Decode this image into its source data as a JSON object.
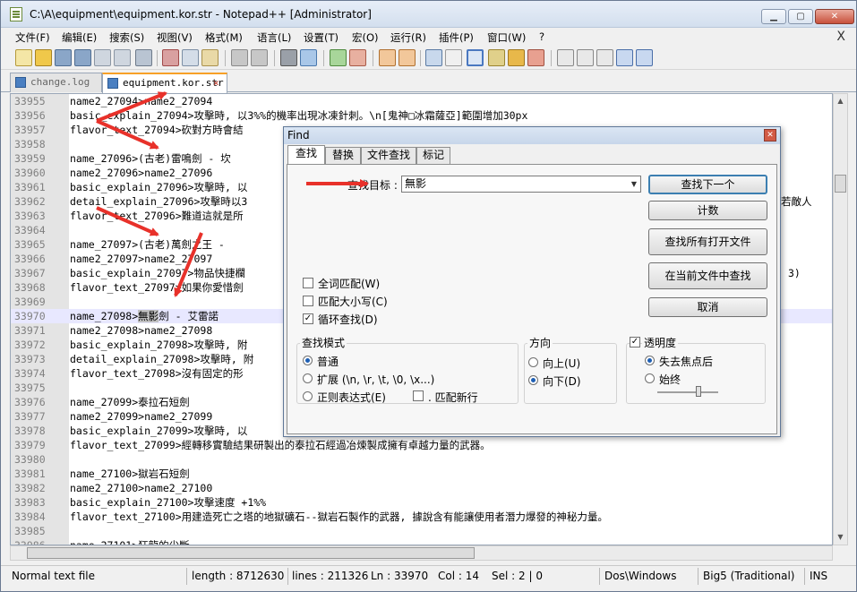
{
  "window": {
    "title": "C:\\A\\equipment\\equipment.kor.str - Notepad++ [Administrator]",
    "min_label": "▁",
    "max_label": "▢",
    "close_label": "✕"
  },
  "menu": {
    "items": [
      "文件(F)",
      "编辑(E)",
      "搜索(S)",
      "视图(V)",
      "格式(M)",
      "语言(L)",
      "设置(T)",
      "宏(O)",
      "运行(R)",
      "插件(P)",
      "窗口(W)",
      "?"
    ],
    "close": "X"
  },
  "tabs": [
    {
      "label": "change.log"
    },
    {
      "label": "equipment.kor.str"
    }
  ],
  "editor": {
    "lines": [
      {
        "num": "33955",
        "text": "name2_27094>name2_27094"
      },
      {
        "num": "33956",
        "text": "basic_explain_27094>攻擊時, 以3%%的機率出現冰凍針刺。\\n[鬼神□冰霜薩亞]範圍增加30px"
      },
      {
        "num": "33957",
        "text": "flavor_text_27094>砍對方時會結"
      },
      {
        "num": "33958",
        "text": ""
      },
      {
        "num": "33959",
        "text": "name_27096>(古老)雷鳴劍 - 坎"
      },
      {
        "num": "33960",
        "text": "name2_27096>name2_27096"
      },
      {
        "num": "33961",
        "text": "basic_explain_27096>攻擊時, 以"
      },
      {
        "num": "33962",
        "text": "detail_explain_27096>攻擊時以3"
      },
      {
        "num": "33963",
        "text": "flavor_text_27096>難道這就是所"
      },
      {
        "num": "33964",
        "text": ""
      },
      {
        "num": "33965",
        "text": "name_27097>(古老)萬劍之王 -"
      },
      {
        "num": "33966",
        "text": "name2_27097>name2_27097"
      },
      {
        "num": "33967",
        "text": "basic_explain_27097>物品快捷欄"
      },
      {
        "num": "33968",
        "text": "flavor_text_27097>如果你愛惜劍"
      },
      {
        "num": "33969",
        "text": ""
      },
      {
        "num": "33970",
        "text": "name_27098>",
        "hl": "無影",
        "rest": "劍 - 艾雷諾"
      },
      {
        "num": "33971",
        "text": "name2_27098>name2_27098"
      },
      {
        "num": "33972",
        "text": "basic_explain_27098>攻擊時, 附"
      },
      {
        "num": "33973",
        "text": "detail_explain_27098>攻擊時, 附"
      },
      {
        "num": "33974",
        "text": "flavor_text_27098>沒有固定的形"
      },
      {
        "num": "33975",
        "text": ""
      },
      {
        "num": "33976",
        "text": "name_27099>泰拉石短劍"
      },
      {
        "num": "33977",
        "text": "name2_27099>name2_27099"
      },
      {
        "num": "33978",
        "text": "basic_explain_27099>攻擊時, 以"
      },
      {
        "num": "33979",
        "text": "flavor_text_27099>經轉移實驗結果研製出的泰拉石經過冶煉製成擁有卓越力量的武器。"
      },
      {
        "num": "33980",
        "text": ""
      },
      {
        "num": "33981",
        "text": "name_27100>獄岩石短劍"
      },
      {
        "num": "33982",
        "text": "name2_27100>name2_27100"
      },
      {
        "num": "33983",
        "text": "basic_explain_27100>攻擊速度 +1%%"
      },
      {
        "num": "33984",
        "text": "flavor_text_27100>用建造死亡之塔的地獄礦石--獄岩石製作的武器, 據說含有能讓使用者潛力爆發的神秘力量。"
      },
      {
        "num": "33985",
        "text": ""
      },
      {
        "num": "33986",
        "text": "name_27101>狂龍的尖斷"
      }
    ],
    "right_fragments": {
      "l33962": "若敵人",
      "l33967": "3)"
    }
  },
  "statusbar": {
    "type": "Normal text file",
    "length": "length : 8712630",
    "lines": "lines : 211326",
    "ln": "Ln : 33970",
    "col": "Col : 14",
    "sel": "Sel : 2 | 0",
    "eol": "Dos\\Windows",
    "encoding": "Big5 (Traditional)",
    "ins": "INS"
  },
  "find_dialog": {
    "title": "Find",
    "tabs": [
      "查找",
      "替换",
      "文件查找",
      "标记"
    ],
    "find_label": "查找目标 :",
    "find_value": "無影",
    "buttons": {
      "find_next": "查找下一个",
      "count": "计数",
      "find_all_open": "查找所有打开文件",
      "find_in_current": "在当前文件中查找",
      "cancel": "取消"
    },
    "options": {
      "whole_word": "全词匹配(W)",
      "match_case": "匹配大小写(C)",
      "wrap": "循环查找(D)"
    },
    "search_mode": {
      "title": "查找模式",
      "normal": "普通",
      "extended": "扩展 (\\n, \\r, \\t, \\0, \\x...)",
      "regex": "正则表达式(E)",
      "dot_newline": ". 匹配新行"
    },
    "direction": {
      "title": "方向",
      "up": "向上(U)",
      "down": "向下(D)"
    },
    "transparency": {
      "title": "透明度",
      "on_lose_focus": "失去焦点后",
      "always": "始终"
    }
  },
  "colors": {
    "arrow": "#e8312a",
    "current_line": "#e8e8ff",
    "tab_accent": "#f7a027"
  }
}
